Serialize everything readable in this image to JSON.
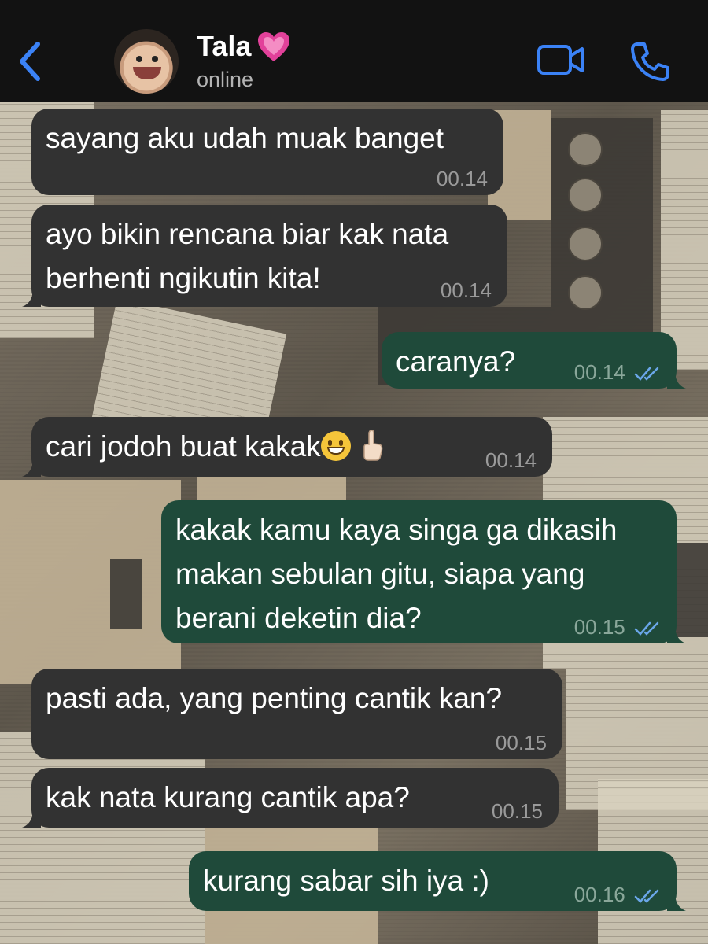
{
  "header": {
    "contact_name": "Tala",
    "status": "online"
  },
  "icons": {
    "back": "chevron-left-icon",
    "heart": "pink-heart-icon",
    "video": "video-camera-icon",
    "call": "phone-icon",
    "read_receipt": "double-check-icon"
  },
  "colors": {
    "accent": "#3b82f6",
    "incoming_bubble": "#323232",
    "outgoing_bubble": "#1f4a3a",
    "read_ticks": "#6aa6e8"
  },
  "messages": [
    {
      "direction": "in",
      "text": "sayang aku udah muak banget",
      "time": "00.14"
    },
    {
      "direction": "in",
      "text": "ayo bikin rencana biar kak nata\nberhenti ngikutin kita!",
      "time": "00.14"
    },
    {
      "direction": "out",
      "text": "caranya?",
      "time": "00.14",
      "read": true
    },
    {
      "direction": "in",
      "text": "cari jodoh buat kakak",
      "emojis": [
        "grinning-face-emoji",
        "index-pointing-up-emoji"
      ],
      "time": "00.14"
    },
    {
      "direction": "out",
      "text": "kakak kamu kaya singa ga dikasih\nmakan sebulan gitu, siapa yang\nberani deketin dia?",
      "time": "00.15",
      "read": true
    },
    {
      "direction": "in",
      "text": "pasti ada, yang penting cantik kan?",
      "time": "00.15"
    },
    {
      "direction": "in",
      "text": "kak nata kurang cantik apa?",
      "time": "00.15"
    },
    {
      "direction": "out",
      "text": "kurang sabar sih iya :)",
      "time": "00.16",
      "read": true
    }
  ]
}
